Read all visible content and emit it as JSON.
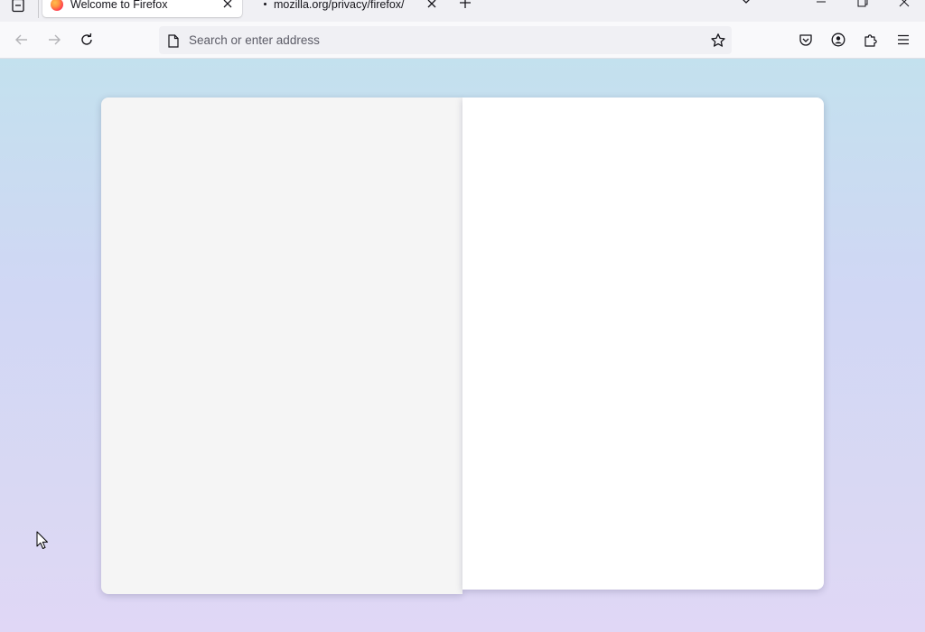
{
  "browser": {
    "tabs": [
      {
        "title": "Welcome to Firefox",
        "active": true
      },
      {
        "title": "mozilla.org/privacy/firefox/",
        "active": false
      }
    ],
    "address_bar": {
      "placeholder": "Search or enter address",
      "value": ""
    }
  },
  "icons": {
    "tab_list": "tab-list-icon",
    "tab_favicon": "firefox-logo-icon",
    "tab_close": "close-icon",
    "new_tab": "plus-icon",
    "list_all_tabs": "chevron-down-icon",
    "minimize": "minimize-icon",
    "restore": "restore-icon",
    "window_close": "close-icon",
    "back": "back-arrow-icon",
    "forward": "forward-arrow-icon",
    "reload": "reload-icon",
    "page": "page-icon",
    "bookmark": "star-icon",
    "pocket": "pocket-icon",
    "account": "account-icon",
    "extensions": "puzzle-icon",
    "menu": "hamburger-menu-icon"
  },
  "colors": {
    "toolbar": "#f9f9fb",
    "tabbar": "#f0f0f4",
    "content_gradient_top": "#c3e1ee",
    "content_gradient_bottom": "#e0d7f6",
    "card_left": "#f5f5f5",
    "card_right": "#ffffff"
  }
}
